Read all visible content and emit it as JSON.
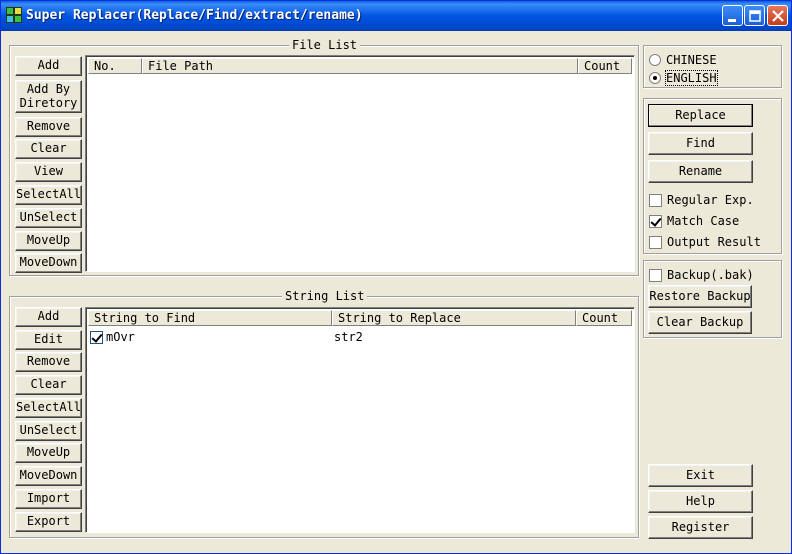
{
  "window": {
    "title": "Super Replacer(Replace/Find/extract/rename)"
  },
  "file_list": {
    "legend": "File List",
    "buttons": [
      "Add",
      "Add By\nDiretory",
      "Remove",
      "Clear",
      "View",
      "SelectAll",
      "UnSelect",
      "MoveUp",
      "MoveDown"
    ],
    "columns": [
      "No.",
      "File Path",
      "Count"
    ],
    "rows": []
  },
  "string_list": {
    "legend": "String List",
    "buttons": [
      "Add",
      "Edit",
      "Remove",
      "Clear",
      "SelectAll",
      "UnSelect",
      "MoveUp",
      "MoveDown",
      "Import",
      "Export"
    ],
    "columns": [
      "String to Find",
      "String to Replace",
      "Count"
    ],
    "rows": [
      {
        "checked": true,
        "find": "mOvr",
        "replace": "str2",
        "count": ""
      }
    ]
  },
  "language": {
    "options": [
      {
        "label": "CHINESE",
        "selected": false
      },
      {
        "label": "ENGLISH",
        "selected": true
      }
    ]
  },
  "actions": {
    "replace": "Replace",
    "find": "Find",
    "rename": "Rename",
    "regular_exp": {
      "label": "Regular Exp.",
      "checked": false
    },
    "match_case": {
      "label": "Match Case",
      "checked": true
    },
    "output_result": {
      "label": "Output Result",
      "checked": false
    }
  },
  "backup": {
    "backup_check": {
      "label": "Backup(.bak)",
      "checked": false
    },
    "restore": "Restore Backup",
    "clear": "Clear Backup"
  },
  "footer": {
    "exit": "Exit",
    "help": "Help",
    "register": "Register"
  }
}
